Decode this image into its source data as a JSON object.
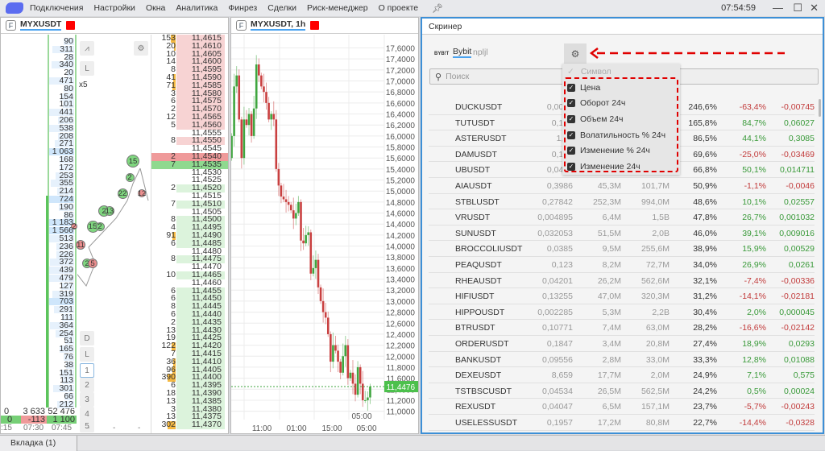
{
  "menu": {
    "items": [
      "Подключения",
      "Настройки",
      "Окна",
      "Аналитика",
      "Финрез",
      "Сделки",
      "Риск-менеджер",
      "О проекте"
    ],
    "clock": "07:54:59",
    "minimize": "—",
    "maximize": "☐",
    "close": "✕"
  },
  "orderbook": {
    "title": "MYXUSDT",
    "badge": "F",
    "cluster_volumes": [
      "90",
      "311",
      "28",
      "340",
      "20",
      "471",
      "80",
      "154",
      "101",
      "441",
      "206",
      "538",
      "208",
      "271",
      "1 063",
      "168",
      "172",
      "253",
      "355",
      "214",
      "724",
      "190",
      "86",
      "1 183",
      "1 566",
      "513",
      "236",
      "226",
      "372",
      "439",
      "479",
      "127",
      "319",
      "703",
      "291",
      "111",
      "364",
      "254",
      "51",
      "165",
      "76",
      "38",
      "151",
      "113",
      "301",
      "66",
      "212"
    ],
    "prices": [
      "11,4615",
      "11,4610",
      "11,4605",
      "11,4600",
      "11,4595",
      "11,4590",
      "11,4585",
      "11,4580",
      "11,4575",
      "11,4570",
      "11,4565",
      "11,4560",
      "11,4555",
      "11,4550",
      "11,4545",
      "11,4540",
      "11,4535",
      "11,4530",
      "11,4525",
      "11,4520",
      "11,4515",
      "11,4510",
      "11,4505",
      "11,4500",
      "11,4495",
      "11,4490",
      "11,4485",
      "11,4480",
      "11,4475",
      "11,4470",
      "11,4465",
      "11,4460",
      "11,4455",
      "11,4450",
      "11,4445",
      "11,4440",
      "11,4435",
      "11,4430",
      "11,4425",
      "11,4420",
      "11,4415",
      "11,4410",
      "11,4405",
      "11,4400",
      "11,4395",
      "11,4390",
      "11,4385",
      "11,4380",
      "11,4375",
      "11,4370"
    ],
    "sizes": [
      "153",
      "20",
      "10",
      "14",
      "8",
      "41",
      "71",
      "3",
      "6",
      "2",
      "12",
      "5",
      "",
      "8",
      "",
      "2",
      "7",
      "",
      "",
      "2",
      "",
      "7",
      "",
      "8",
      "4",
      "91",
      "6",
      "",
      "8",
      "",
      "10",
      "",
      "6",
      "6",
      "8",
      "6",
      "2",
      "13",
      "19",
      "122",
      "7",
      "36",
      "96",
      "390",
      "6",
      "18",
      "13",
      "3",
      "13",
      "302"
    ],
    "best_ask_index": 15,
    "best_bid_index": 16,
    "buttons": {
      "multiplier": "x5",
      "L": "L",
      "D": "D",
      "L2": "L",
      "n1": "1",
      "n2": "2",
      "n3": "3",
      "n4": "4",
      "n5": "5"
    },
    "trades": [
      "15",
      "2",
      "22",
      "2",
      "13",
      "15",
      "2",
      "12",
      "11",
      "2",
      "5",
      "2"
    ],
    "footer": {
      "row1": [
        "0",
        "3 633",
        "52 476"
      ],
      "row2": [
        "0",
        "-113",
        "1 100"
      ],
      "times": [
        ":15",
        "07:30",
        "07:45"
      ],
      "dashes": [
        "-",
        "-",
        "-"
      ]
    }
  },
  "chart": {
    "title": "MYXUSDT, 1h",
    "badge": "F",
    "last_price": "11,4476",
    "time_hover": "05:00",
    "price_ticks": [
      "17,6000",
      "17,4000",
      "17,2000",
      "17,0000",
      "16,8000",
      "16,6000",
      "16,4000",
      "16,2000",
      "16,0000",
      "15,8000",
      "15,6000",
      "15,4000",
      "15,2000",
      "15,0000",
      "14,8000",
      "14,6000",
      "14,4000",
      "14,2000",
      "14,0000",
      "13,8000",
      "13,6000",
      "13,4000",
      "13,2000",
      "13,0000",
      "12,8000",
      "12,6000",
      "12,4000",
      "12,2000",
      "12,0000",
      "11,8000",
      "11,6000",
      "11,4000",
      "11,2000",
      "11,0000"
    ],
    "time_ticks": [
      "11:00",
      "01:00",
      "15:00",
      "05:00"
    ],
    "closes": [
      16.0,
      16.9,
      17.1,
      16.3,
      15.6,
      16.3,
      16.2,
      16.4,
      16.0,
      16.5,
      17.3,
      17.1,
      16.9,
      16.8,
      16.6,
      16.3,
      16.4,
      16.3,
      15.4,
      15.1,
      14.9,
      14.85,
      14.8,
      14.75,
      14.65,
      14.5,
      14.6,
      14.8,
      14.1,
      14.05,
      14.2,
      14.25,
      13.5,
      13.6,
      13.75,
      13.25,
      13.0,
      12.8,
      12.7,
      12.4,
      11.9,
      12.2,
      12.1,
      11.9,
      11.7,
      12.0,
      12.2,
      11.6,
      11.7,
      11.5,
      11.3,
      11.8,
      11.5,
      11.2,
      11.2,
      11.25,
      11.45
    ],
    "up_color": "#3fa63f",
    "down_color": "#c94040"
  },
  "screener": {
    "title": "Скринер",
    "exchange_logo": "BYB!T",
    "exchange": "Bybit",
    "account": "npljl",
    "search_placeholder": "Поиск",
    "rows": [
      [
        "DUCKUSDT",
        "0,0043",
        "",
        "",
        "246,6%",
        "-63,4%",
        "-0,00745"
      ],
      [
        "TUTUSDT",
        "0,131",
        "",
        "",
        "165,8%",
        "84,7%",
        "0,06027"
      ],
      [
        "ASTERUSDT",
        "1,00",
        "",
        "",
        "86,5%",
        "44,1%",
        "0,3085"
      ],
      [
        "DAMUSDT",
        "0,103",
        "",
        "",
        "69,6%",
        "-25,0%",
        "-0,03469"
      ],
      [
        "UBUSDT",
        "0,0440",
        "",
        "",
        "66,8%",
        "50,1%",
        "0,014711"
      ],
      [
        "AIAUSDT",
        "0,3986",
        "45,3M",
        "101,7M",
        "50,9%",
        "-1,1%",
        "-0,0046"
      ],
      [
        "STBLUSDT",
        "0,27842",
        "252,3M",
        "994,0M",
        "48,6%",
        "10,1%",
        "0,02557"
      ],
      [
        "VRUSDT",
        "0,004895",
        "6,4M",
        "1,5B",
        "47,8%",
        "26,7%",
        "0,001032"
      ],
      [
        "SUNUSDT",
        "0,032053",
        "51,5M",
        "2,0B",
        "46,0%",
        "39,1%",
        "0,009016"
      ],
      [
        "BROCCOLIUSDT",
        "0,0385",
        "9,5M",
        "255,6M",
        "38,9%",
        "15,9%",
        "0,00529"
      ],
      [
        "PEAQUSDT",
        "0,123",
        "8,2M",
        "72,7M",
        "34,0%",
        "26,9%",
        "0,0261"
      ],
      [
        "RHEAUSDT",
        "0,04201",
        "26,2M",
        "562,6M",
        "32,1%",
        "-7,4%",
        "-0,00336"
      ],
      [
        "HIFIUSDT",
        "0,13255",
        "47,0M",
        "320,3M",
        "31,2%",
        "-14,1%",
        "-0,02181"
      ],
      [
        "HIPPOUSDT",
        "0,002285",
        "5,3M",
        "2,2B",
        "30,4%",
        "2,0%",
        "0,000045"
      ],
      [
        "BTRUSDT",
        "0,10771",
        "7,4M",
        "63,0M",
        "28,2%",
        "-16,6%",
        "-0,02142"
      ],
      [
        "ORDERUSDT",
        "0,1847",
        "3,4M",
        "20,8M",
        "27,4%",
        "18,9%",
        "0,0293"
      ],
      [
        "BANKUSDT",
        "0,09556",
        "2,8M",
        "33,0M",
        "33,3%",
        "12,8%",
        "0,01088"
      ],
      [
        "DEXEUSDT",
        "8,659",
        "17,7M",
        "2,0M",
        "24,9%",
        "7,1%",
        "0,575"
      ],
      [
        "TSTBSCUSDT",
        "0,04534",
        "26,5M",
        "562,5M",
        "24,2%",
        "0,5%",
        "0,00024"
      ],
      [
        "REXUSDT",
        "0,04047",
        "6,5M",
        "157,1M",
        "23,7%",
        "-5,7%",
        "-0,00243"
      ],
      [
        "USELESSUSDT",
        "0,1957",
        "17,2M",
        "80,8M",
        "22,7%",
        "-14,4%",
        "-0,0328"
      ]
    ],
    "column_menu": {
      "disabled_item": "Символ",
      "items": [
        "Цена",
        "Оборот 24ч",
        "Объем 24ч",
        "Волатильность % 24ч",
        "Изменение % 24ч",
        "Изменение 24ч"
      ],
      "checked": [
        true,
        true,
        true,
        true,
        true,
        true
      ]
    },
    "positive_color": "#3a9a3a",
    "negative_color": "#c23b3b",
    "annotation_color": "#e00000"
  },
  "tabs": {
    "items": [
      "Вкладка (1)"
    ]
  }
}
